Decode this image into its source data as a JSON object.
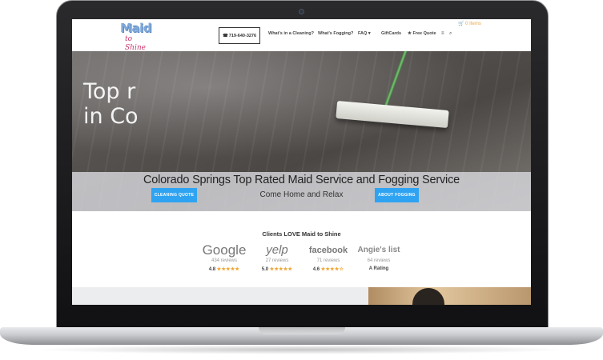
{
  "site": {
    "logo_main": "Maid",
    "logo_sub": "to Shine",
    "phone": "719-640-3276",
    "cart": "0 Items",
    "nav": [
      {
        "label": "What's in a Cleaning?"
      },
      {
        "label": "What's Fogging?"
      },
      {
        "label": "FAQ"
      },
      {
        "label": "GiftCards"
      },
      {
        "label": "Free Quote"
      }
    ]
  },
  "hero": {
    "big_text": "Top r\nin Co",
    "title": "Colorado Springs Top Rated Maid Service and Fogging Service",
    "subtitle": "Come Home and Relax",
    "btn_cleaning": "CLEANING QUOTE",
    "btn_fogging": "ABOUT FOGGING"
  },
  "reviews": {
    "heading": "Clients LOVE Maid to Shine",
    "items": [
      {
        "logo": "Google",
        "count": "434 reviews",
        "score": "4.8",
        "stars": "★★★★★"
      },
      {
        "logo": "yelp",
        "count": "27 reviews",
        "score": "5.0",
        "stars": "★★★★★"
      },
      {
        "logo": "facebook",
        "count": "71 reviews",
        "score": "4.6",
        "stars": "★★★★☆"
      },
      {
        "logo": "Angie's list",
        "count": "64 reviews",
        "score": "A Rating",
        "stars": ""
      }
    ]
  },
  "icons": {
    "phone": "phone-icon",
    "cart": "cart-icon",
    "menu": "menu-icon",
    "search": "search-icon"
  },
  "colors": {
    "accent_blue": "#2ea3f2",
    "star_orange": "#f0a22a",
    "cart_orange": "#e8a84a",
    "logo_blue": "#7fa9d9",
    "logo_pink": "#c8366b"
  }
}
